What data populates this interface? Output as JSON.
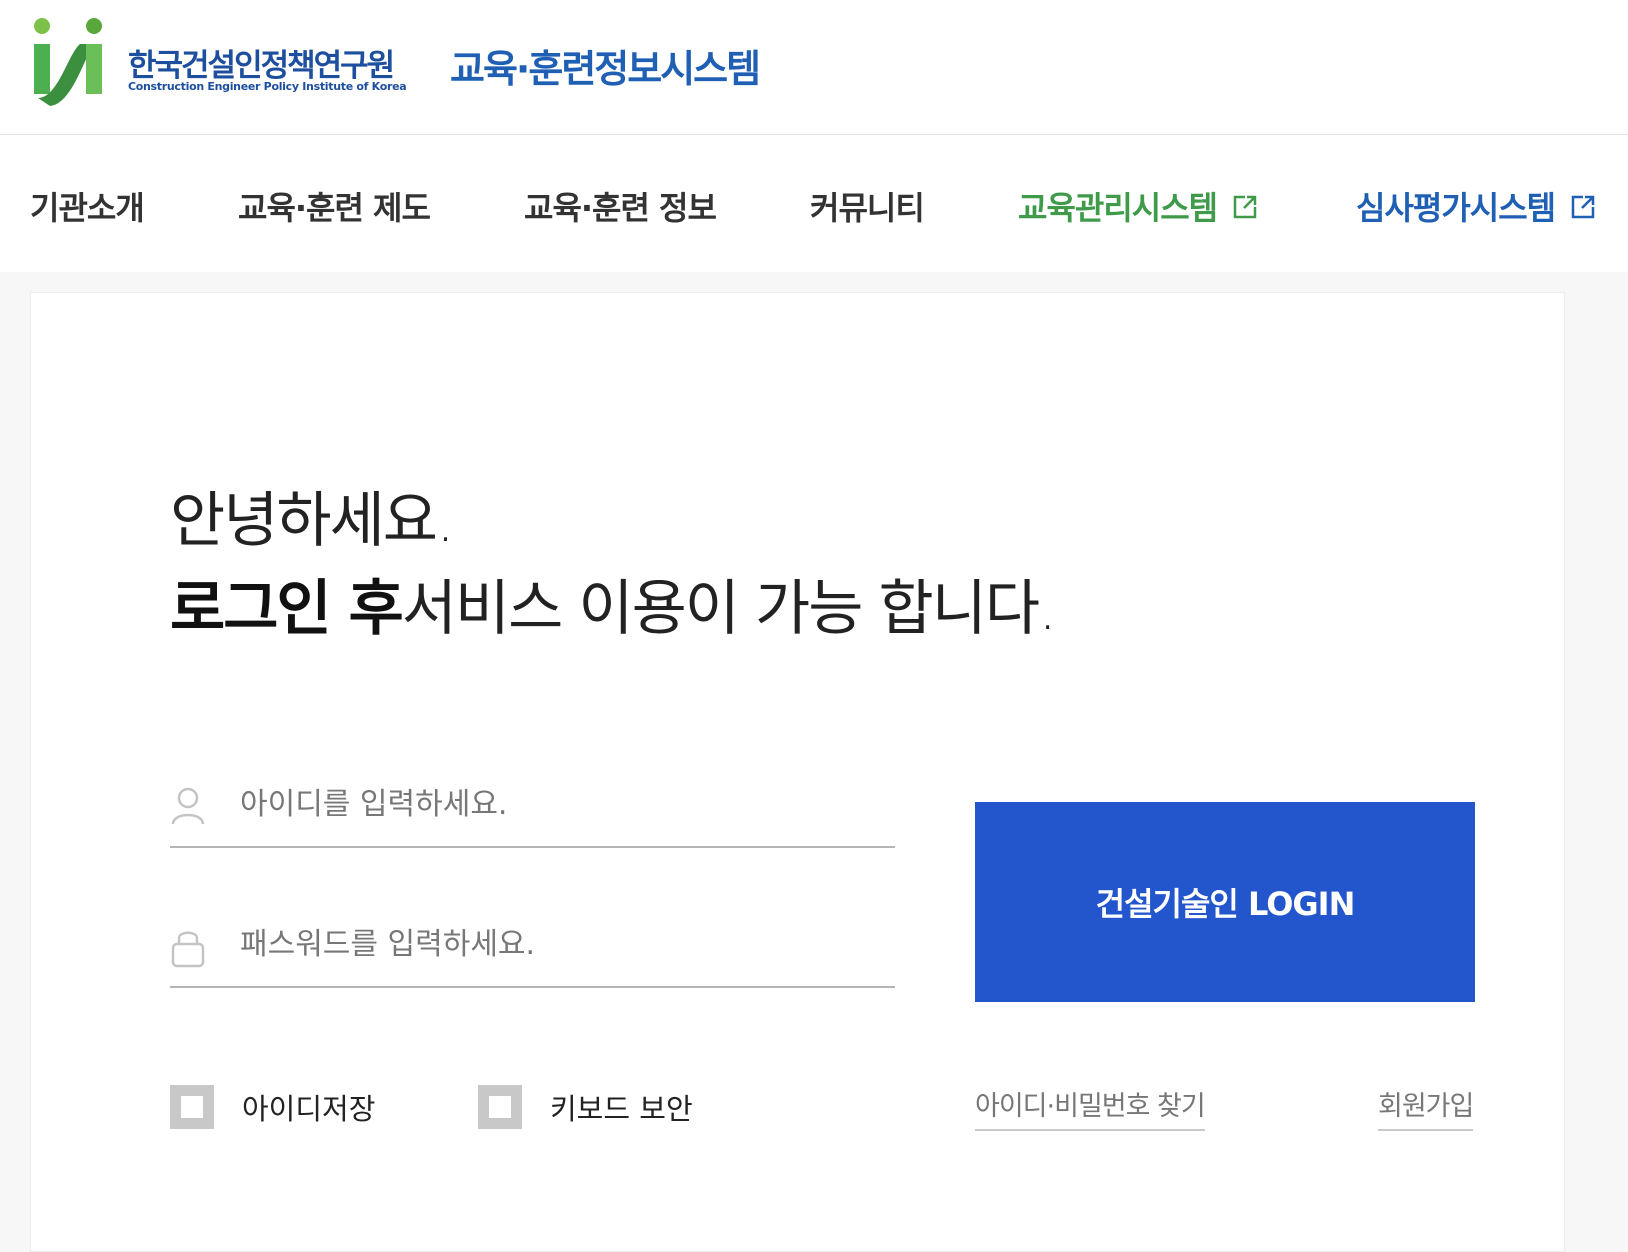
{
  "header": {
    "org_name": "한국건설인정책연구원",
    "org_name_en": "Construction Engineer Policy Institute of Korea",
    "system_title": "교육·훈련정보시스템"
  },
  "nav": {
    "items": [
      {
        "label": "기관소개"
      },
      {
        "label": "교육·훈련 제도"
      },
      {
        "label": "교육·훈련 정보"
      },
      {
        "label": "커뮤니티"
      },
      {
        "label": "교육관리시스템",
        "color": "#3f9a4a"
      },
      {
        "label": "심사평가시스템",
        "color": "#1f5fb4"
      }
    ]
  },
  "greeting": {
    "line1": "안녕하세요.",
    "line2_bold": "로그인 후",
    "line2_rest": "서비스 이용이 가능 합니다."
  },
  "form": {
    "id_placeholder": "아이디를 입력하세요.",
    "pw_placeholder": "패스워드를 입력하세요.",
    "login_label": "건설기술인 LOGIN",
    "save_id_label": "아이디저장",
    "keyboard_security_label": "키보드 보안",
    "find_label": "아이디·비밀번호 찾기",
    "signup_label": "회원가입"
  },
  "colors": {
    "primary_blue": "#2356cd",
    "brand_blue": "#1e4f9e",
    "brand_green": "#3f9a4a"
  }
}
